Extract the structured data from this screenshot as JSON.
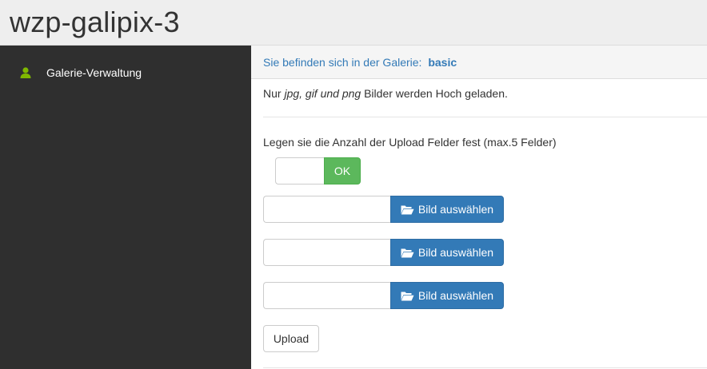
{
  "header": {
    "title": "wzp-galipix-3"
  },
  "sidebar": {
    "items": [
      {
        "label": "Galerie-Verwaltung",
        "icon": "user-icon",
        "icon_color": "#7fb800"
      }
    ]
  },
  "breadcrumb": {
    "prefix": "Sie befinden sich in der Galerie:",
    "gallery": "basic"
  },
  "info": {
    "prefix": "Nur",
    "formats": "jpg, gif und png",
    "suffix": "Bilder werden Hoch geladen."
  },
  "upload_count": {
    "label": "Legen sie die Anzahl der Upload Felder fest (max.5 Felder)",
    "value": "",
    "ok_label": "OK"
  },
  "file_fields": [
    {
      "value": "",
      "button_label": "Bild auswählen",
      "icon": "folder-open-icon"
    },
    {
      "value": "",
      "button_label": "Bild auswählen",
      "icon": "folder-open-icon"
    },
    {
      "value": "",
      "button_label": "Bild auswählen",
      "icon": "folder-open-icon"
    }
  ],
  "upload_button": {
    "label": "Upload"
  },
  "colors": {
    "primary": "#337ab7",
    "success": "#5cb85c",
    "sidebar_bg": "#2f2f2f",
    "header_bg": "#eeeeee"
  }
}
